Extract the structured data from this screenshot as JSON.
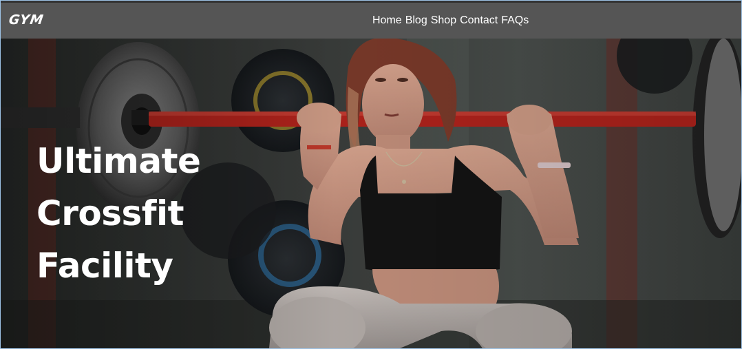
{
  "brand": {
    "logo_text": "GYM"
  },
  "nav": {
    "items": [
      {
        "label": "Home"
      },
      {
        "label": "Blog"
      },
      {
        "label": "Shop"
      },
      {
        "label": "Contact"
      },
      {
        "label": "FAQs"
      }
    ]
  },
  "hero": {
    "title_lines": [
      "Ultimate",
      "Crossfit",
      "Facility"
    ],
    "background_image": "woman-squatting-barbell-photo"
  },
  "colors": {
    "navbar_bg": "#555555",
    "text": "#ffffff",
    "barbell_red": "#b2231c"
  }
}
